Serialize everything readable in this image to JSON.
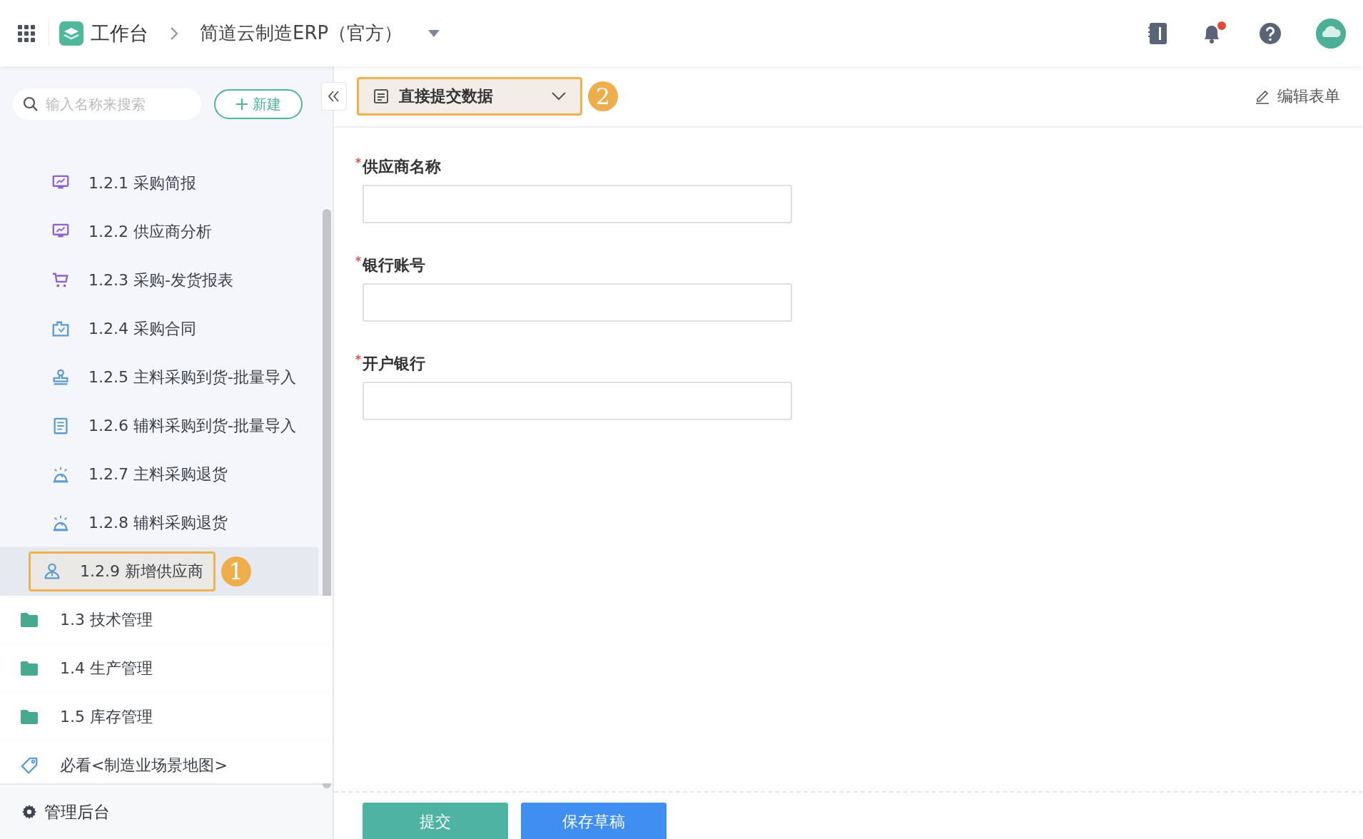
{
  "topbar": {
    "app_name": "工作台",
    "breadcrumb": "简道云制造ERP（官方）",
    "notification_dot": true
  },
  "sidebar": {
    "search": {
      "placeholder": "输入名称来搜索"
    },
    "new_button": "新建",
    "items": [
      {
        "kind": "group",
        "children": [
          {
            "label": "1.2.1 采购简报",
            "kind": "report",
            "selected": false
          },
          {
            "label": "1.2.2 供应商分析",
            "kind": "report",
            "selected": false
          },
          {
            "label": "1.2.3 采购-发货报表",
            "kind": "cart",
            "selected": false
          },
          {
            "label": "1.2.4 采购合同",
            "kind": "contract",
            "selected": false
          },
          {
            "label": "1.2.5 主料采购到货-批量导入",
            "kind": "import",
            "selected": false
          },
          {
            "label": "1.2.6 辅料采购到货-批量导入",
            "kind": "list",
            "selected": false
          },
          {
            "label": "1.2.7 主料采购退货",
            "kind": "return",
            "selected": false
          },
          {
            "label": "1.2.8 辅料采购退货",
            "kind": "return",
            "selected": false
          },
          {
            "label": "1.2.9 新增供应商",
            "kind": "supplier",
            "selected": true,
            "callout": "1"
          }
        ]
      },
      {
        "kind": "folder",
        "label": "1.3 技术管理",
        "selected": false
      },
      {
        "kind": "folder",
        "label": "1.4 生产管理",
        "selected": false
      },
      {
        "kind": "folder",
        "label": "1.5 库存管理",
        "selected": false
      },
      {
        "kind": "tag",
        "label": "必看<制造业场景地图>",
        "selected": false
      }
    ],
    "footer": "管理后台"
  },
  "form": {
    "mode_button": {
      "label": "直接提交数据",
      "callout": "2"
    },
    "edit_button": "编辑表单",
    "fields": [
      {
        "label": "供应商名称",
        "required": true
      },
      {
        "label": "银行账号",
        "required": true
      },
      {
        "label": "开户银行",
        "required": true
      }
    ],
    "buttons": [
      {
        "label": "提交",
        "kind": "submit"
      },
      {
        "label": "保存草稿",
        "kind": "draft"
      }
    ]
  }
}
